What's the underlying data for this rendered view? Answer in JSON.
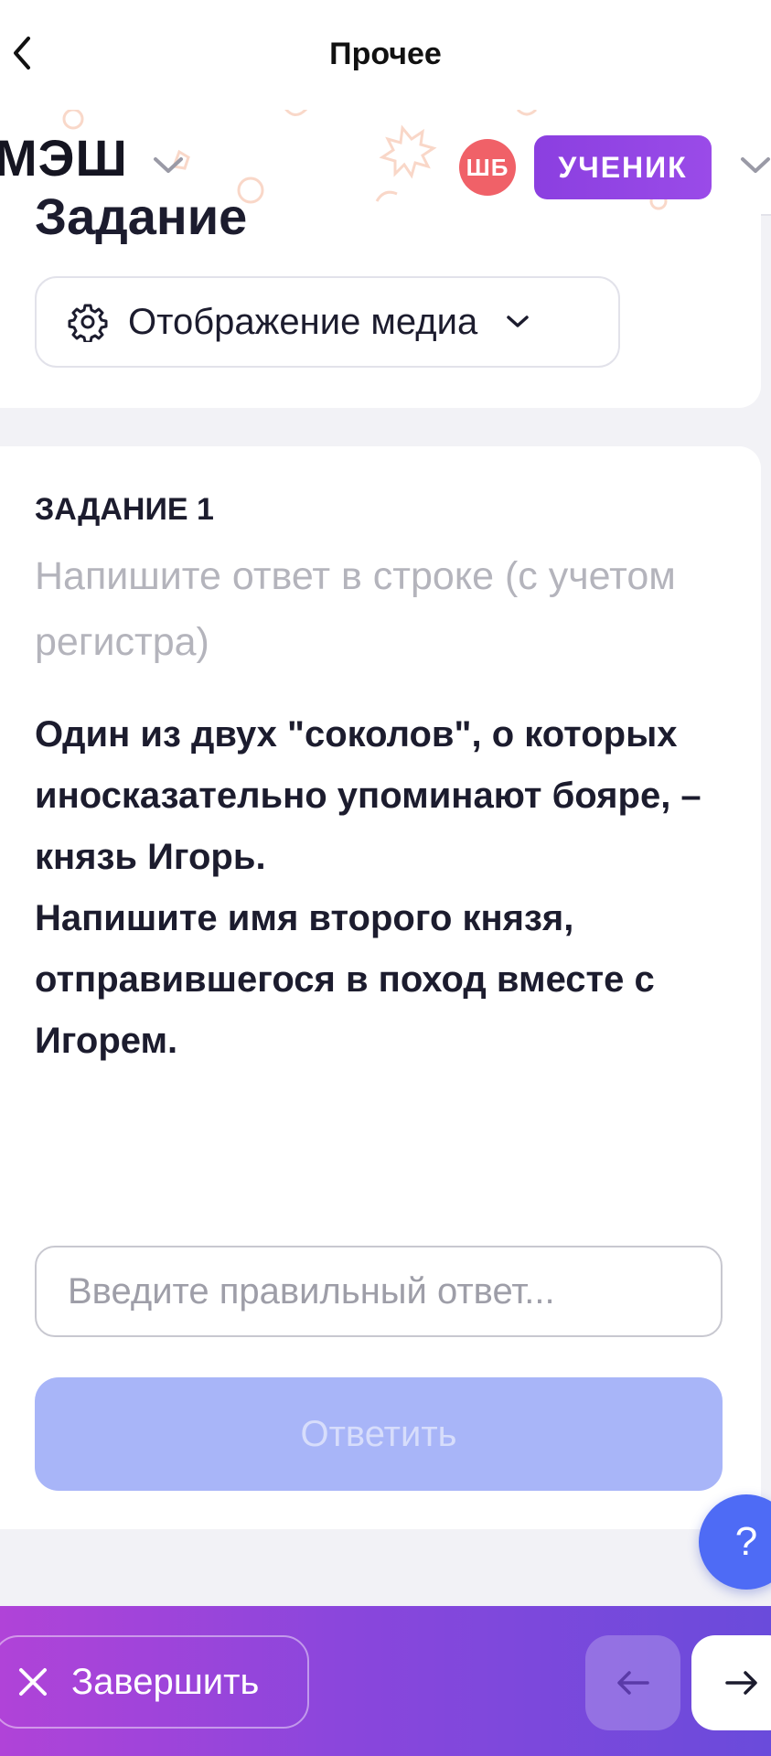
{
  "nav": {
    "title": "Прочее"
  },
  "header": {
    "logo": "МЭШ",
    "avatar_initials": "ШБ",
    "role_label": "УЧЕНИК",
    "avatar_color": "#f06168",
    "role_color": "#8b3fe0"
  },
  "section": {
    "title": "Задание",
    "media_button_label": "Отображение медиа"
  },
  "task": {
    "number_label": "ЗАДАНИЕ 1",
    "instruction": "Напишите ответ в строке (с учетом регистра)",
    "question": "Один из двух \"соколов\", о которых иносказательно упоминают бояре, – князь Игорь.\nНапишите имя второго князя, отправившегося в поход вместе с Игорем.",
    "answer_placeholder": "Введите правильный ответ...",
    "answer_value": "",
    "submit_label": "Ответить"
  },
  "help": {
    "label": "?"
  },
  "footer": {
    "finish_label": "Завершить"
  },
  "icons": {
    "back": "chevron-left-icon",
    "gear": "gear-icon",
    "dropdown": "chevron-down-icon",
    "close": "close-icon",
    "prev": "arrow-left-icon",
    "next": "arrow-right-icon"
  },
  "colors": {
    "accent": "#4e6bf5",
    "submit_disabled": "#a8b5f8",
    "bottom_gradient_start": "#b043d8",
    "bottom_gradient_end": "#6a4bdb"
  }
}
